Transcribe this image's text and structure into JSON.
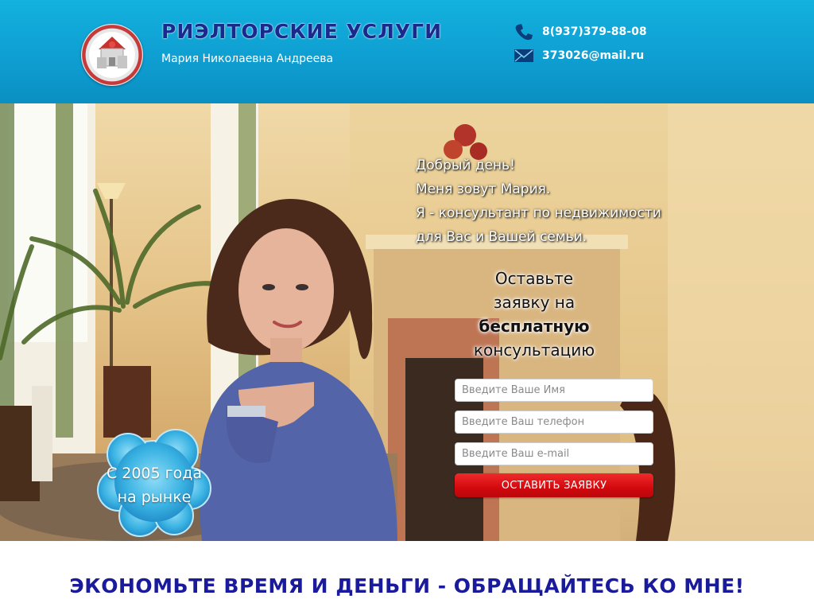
{
  "header": {
    "title": "РИЭЛТОРСКИЕ УСЛУГИ",
    "subtitle": "Мария Николаевна Андреева",
    "phone": "8(937)379-88-08",
    "email": "373026@mail.ru",
    "icons": {
      "logo": "house-logo-icon",
      "phone": "phone-icon",
      "email": "envelope-icon"
    }
  },
  "hero": {
    "greeting": [
      "Добрый день!",
      "Меня зовут Мария.",
      "Я - консультант по недвижимости",
      "для Вас и Вашей семьи."
    ],
    "cta": {
      "line1": "Оставьте",
      "line2": "заявку на",
      "bold": "бесплатную",
      "line4": "консультацию"
    },
    "form": {
      "name_placeholder": "Введите Ваше Имя",
      "phone_placeholder": "Введите Ваш телефон",
      "email_placeholder": "Введите Ваш e-mail",
      "submit_label": "ОСТАВИТЬ ЗАЯВКУ"
    },
    "badge": {
      "line1": "С 2005 года",
      "line2": "на рынке"
    }
  },
  "tagline": "ЭКОНОМЬТЕ ВРЕМЯ И ДЕНЬГИ - ОБРАЩАЙТЕСЬ КО МНЕ!",
  "colors": {
    "header_blue": "#0fa6d9",
    "title_navy": "#1a2a8c",
    "submit_red": "#d3090e",
    "badge_blue": "#2aa3d6"
  }
}
